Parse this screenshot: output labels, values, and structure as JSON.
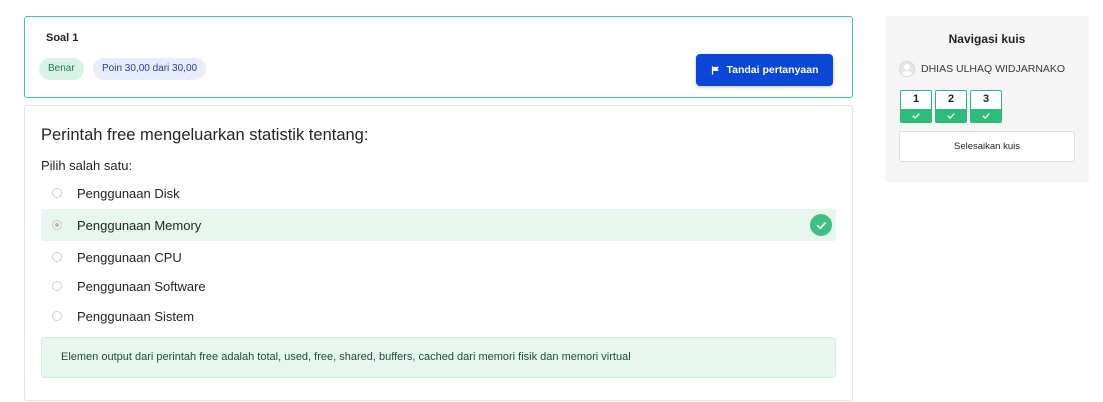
{
  "question_info": {
    "title": "Soal 1",
    "status_badge": "Benar",
    "points_badge": "Poin 30,00 dari 30,00",
    "flag_button": "Tandai pertanyaan",
    "flag_icon": "flag-icon"
  },
  "question": {
    "text": "Perintah free mengeluarkan statistik tentang:",
    "prompt": "Pilih salah satu:",
    "options": [
      {
        "label": "Penggunaan Disk",
        "selected": false,
        "correct": false
      },
      {
        "label": "Penggunaan Memory",
        "selected": true,
        "correct": true
      },
      {
        "label": "Penggunaan CPU",
        "selected": false,
        "correct": false
      },
      {
        "label": "Penggunaan Software",
        "selected": false,
        "correct": false
      },
      {
        "label": "Penggunaan Sistem",
        "selected": false,
        "correct": false
      }
    ],
    "feedback": "Elemen output dari perintah free adalah total, used, free, shared, buffers, cached dari memori fisik dan memori virtual"
  },
  "quiz_navigation": {
    "title": "Navigasi kuis",
    "user_name": "DHIAS ULHAQ WIDJARNAKO",
    "questions": [
      {
        "number": "1",
        "state": "correct"
      },
      {
        "number": "2",
        "state": "correct"
      },
      {
        "number": "3",
        "state": "correct"
      }
    ],
    "finish_button": "Selesaikan kuis"
  },
  "colors": {
    "accent": "#0b46d6",
    "correct": "#2ebc7c",
    "correct_bg": "#e8f7ee"
  }
}
